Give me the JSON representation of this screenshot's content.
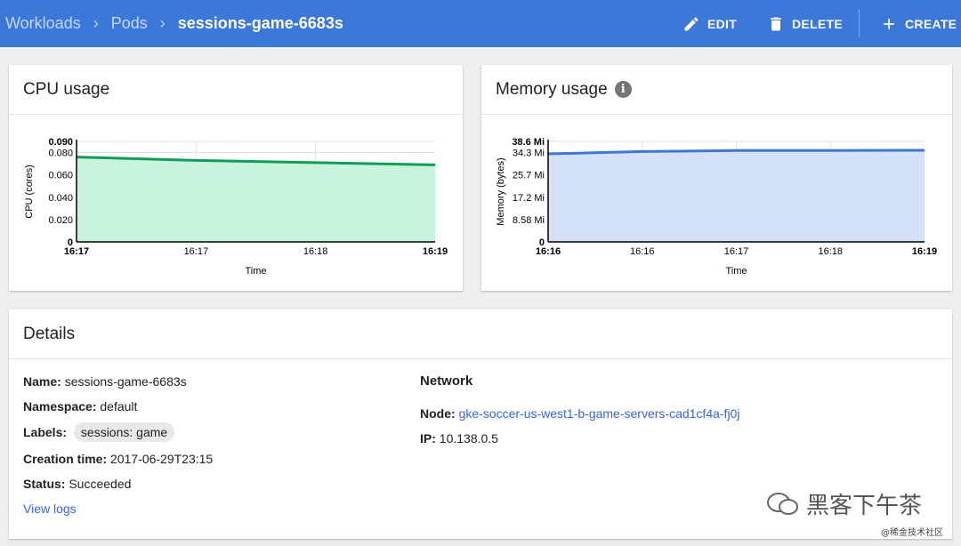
{
  "breadcrumb": {
    "items": [
      "Workloads",
      "Pods"
    ],
    "current": "sessions-game-6683s"
  },
  "actions": {
    "edit": "EDIT",
    "delete": "DELETE",
    "create": "CREATE"
  },
  "cpu_card": {
    "title": "CPU usage"
  },
  "memory_card": {
    "title": "Memory usage",
    "info_icon": "info-icon"
  },
  "chart_data": [
    {
      "type": "area",
      "title": "CPU usage",
      "ylabel": "CPU (cores)",
      "xlabel": "Time",
      "y_ticks": [
        "0",
        "0.020",
        "0.040",
        "0.060",
        "0.080",
        "0.090"
      ],
      "ylim": [
        0,
        0.09
      ],
      "x_ticks": [
        "16:17",
        "16:17",
        "16:18",
        "16:19"
      ],
      "series": [
        {
          "values": [
            0.076,
            0.073,
            0.071,
            0.069
          ]
        }
      ],
      "color": "#0f9d58",
      "fill": "#c8f3dc"
    },
    {
      "type": "area",
      "title": "Memory usage",
      "ylabel": "Memory (bytes)",
      "xlabel": "Time",
      "y_ticks": [
        "0",
        "8.58 Mi",
        "17.2 Mi",
        "25.7 Mi",
        "34.3 Mi",
        "38.6 Mi"
      ],
      "ylim": [
        0,
        38.6
      ],
      "x_ticks": [
        "16:16",
        "16:16",
        "16:17",
        "16:18",
        "16:19"
      ],
      "series": [
        {
          "values": [
            33.8,
            34.7,
            35.1,
            35.1,
            35.2
          ]
        }
      ],
      "color": "#3c78d8",
      "fill": "#d4e1f7"
    }
  ],
  "details": {
    "title": "Details",
    "name_label": "Name:",
    "name_value": "sessions-game-6683s",
    "namespace_label": "Namespace:",
    "namespace_value": "default",
    "labels_label": "Labels:",
    "labels_chip": "sessions: game",
    "creation_label": "Creation time:",
    "creation_value": "2017-06-29T23:15",
    "status_label": "Status:",
    "status_value": "Succeeded",
    "view_logs": "View logs",
    "network_title": "Network",
    "node_label": "Node:",
    "node_value": "gke-soccer-us-west1-b-game-servers-cad1cf4a-fj0j",
    "ip_label": "IP:",
    "ip_value": "10.138.0.5"
  },
  "watermark": {
    "main": "黑客下午茶",
    "sub": "@稀金技术社区"
  }
}
